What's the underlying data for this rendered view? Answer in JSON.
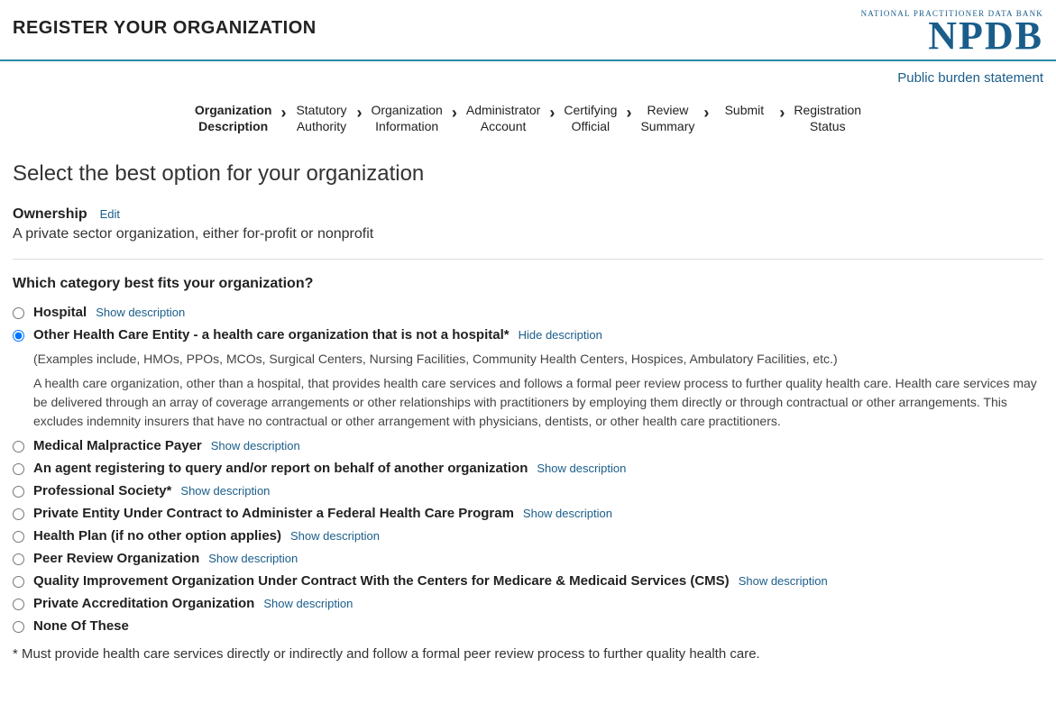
{
  "header": {
    "page_title": "REGISTER YOUR ORGANIZATION",
    "logo_tagline": "NATIONAL PRACTITIONER DATA BANK",
    "logo_text": "NPDB",
    "burden_link": "Public burden statement"
  },
  "stepper": [
    {
      "label_line1": "Organization",
      "label_line2": "Description",
      "active": true
    },
    {
      "label_line1": "Statutory",
      "label_line2": "Authority",
      "active": false
    },
    {
      "label_line1": "Organization",
      "label_line2": "Information",
      "active": false
    },
    {
      "label_line1": "Administrator",
      "label_line2": "Account",
      "active": false
    },
    {
      "label_line1": "Certifying",
      "label_line2": "Official",
      "active": false
    },
    {
      "label_line1": "Review",
      "label_line2": "Summary",
      "active": false
    },
    {
      "label_line1": "Submit",
      "label_line2": "",
      "active": false
    },
    {
      "label_line1": "Registration",
      "label_line2": "Status",
      "active": false
    }
  ],
  "main": {
    "section_title": "Select the best option for your organization",
    "ownership_label": "Ownership",
    "edit_label": "Edit",
    "ownership_value": "A private sector organization, either for-profit or nonprofit",
    "question": "Which category best fits your organization?",
    "show_desc": "Show description",
    "hide_desc": "Hide description",
    "footnote": "* Must provide health care services directly or indirectly and follow a formal peer review process to further quality health care."
  },
  "options": [
    {
      "label": "Hospital",
      "selected": false,
      "expanded": false
    },
    {
      "label": "Other Health Care Entity - a health care organization that is not a hospital*",
      "selected": true,
      "expanded": true,
      "examples": "(Examples include, HMOs, PPOs, MCOs, Surgical Centers, Nursing Facilities, Community Health Centers, Hospices, Ambulatory Facilities, etc.)",
      "description": "A health care organization, other than a hospital, that provides health care services and follows a formal peer review process to further quality health care. Health care services may be delivered through an array of coverage arrangements or other relationships with practitioners by employing them directly or through contractual or other arrangements. This excludes indemnity insurers that have no contractual or other arrangement with physicians, dentists, or other health care practitioners."
    },
    {
      "label": "Medical Malpractice Payer",
      "selected": false,
      "expanded": false
    },
    {
      "label": "An agent registering to query and/or report on behalf of another organization",
      "selected": false,
      "expanded": false
    },
    {
      "label": "Professional Society*",
      "selected": false,
      "expanded": false
    },
    {
      "label": "Private Entity Under Contract to Administer a Federal Health Care Program",
      "selected": false,
      "expanded": false
    },
    {
      "label": "Health Plan (if no other option applies)",
      "selected": false,
      "expanded": false
    },
    {
      "label": "Peer Review Organization",
      "selected": false,
      "expanded": false
    },
    {
      "label": "Quality Improvement Organization Under Contract With the Centers for Medicare & Medicaid Services (CMS)",
      "selected": false,
      "expanded": false
    },
    {
      "label": "Private Accreditation Organization",
      "selected": false,
      "expanded": false
    },
    {
      "label": "None Of These",
      "selected": false,
      "expanded": false,
      "no_desc_link": true
    }
  ]
}
